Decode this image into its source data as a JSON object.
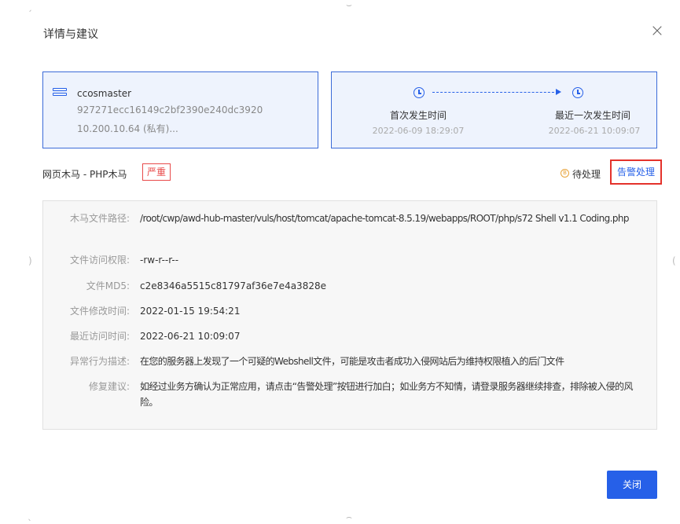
{
  "dialog": {
    "title": "详情与建议",
    "close_symbol": "×"
  },
  "host": {
    "name": "ccosmaster",
    "id": "927271ecc16149c2bf2390e240dc3920",
    "ip": "10.200.10.64 (私有)..."
  },
  "timeline": {
    "first_label": "首次发生时间",
    "first_value": "2022-06-09 18:29:07",
    "last_label": "最近一次发生时间",
    "last_value": "2022-06-21 10:09:07"
  },
  "threat": {
    "title": "网页木马 - PHP木马",
    "severity": "严重",
    "status_glyph": "B",
    "status": "待处理",
    "action": "告警处理"
  },
  "details": [
    {
      "key": "木马文件路径:",
      "value": "/root/cwp/awd-hub-master/vuls/host/tomcat/apache-tomcat-8.5.19/webapps/ROOT/php/s72 Shell v1.1 Coding.php"
    },
    {
      "key": "文件访问权限:",
      "value": "-rw-r--r--"
    },
    {
      "key": "文件MD5:",
      "value": "c2e8346a5515c81797af36e7e4a3828e"
    },
    {
      "key": "文件修改时间:",
      "value": "2022-01-15 19:54:21"
    },
    {
      "key": "最近访问时间:",
      "value": "2022-06-21 10:09:07"
    },
    {
      "key": "异常行为描述:",
      "value": "在您的服务器上发现了一个可疑的Webshell文件，可能是攻击者成功入侵网站后为维持权限植入的后门文件"
    },
    {
      "key": "修复建议:",
      "value": "如经过业务方确认为正常应用，请点击“告警处理”按钮进行加白；如业务方不知情，请登录服务器继续排查，排除被入侵的风险。"
    }
  ],
  "footer": {
    "close_label": "关闭"
  },
  "colors": {
    "primary": "#2660e8",
    "danger": "#e84a4a",
    "warning": "#e8a33a"
  }
}
